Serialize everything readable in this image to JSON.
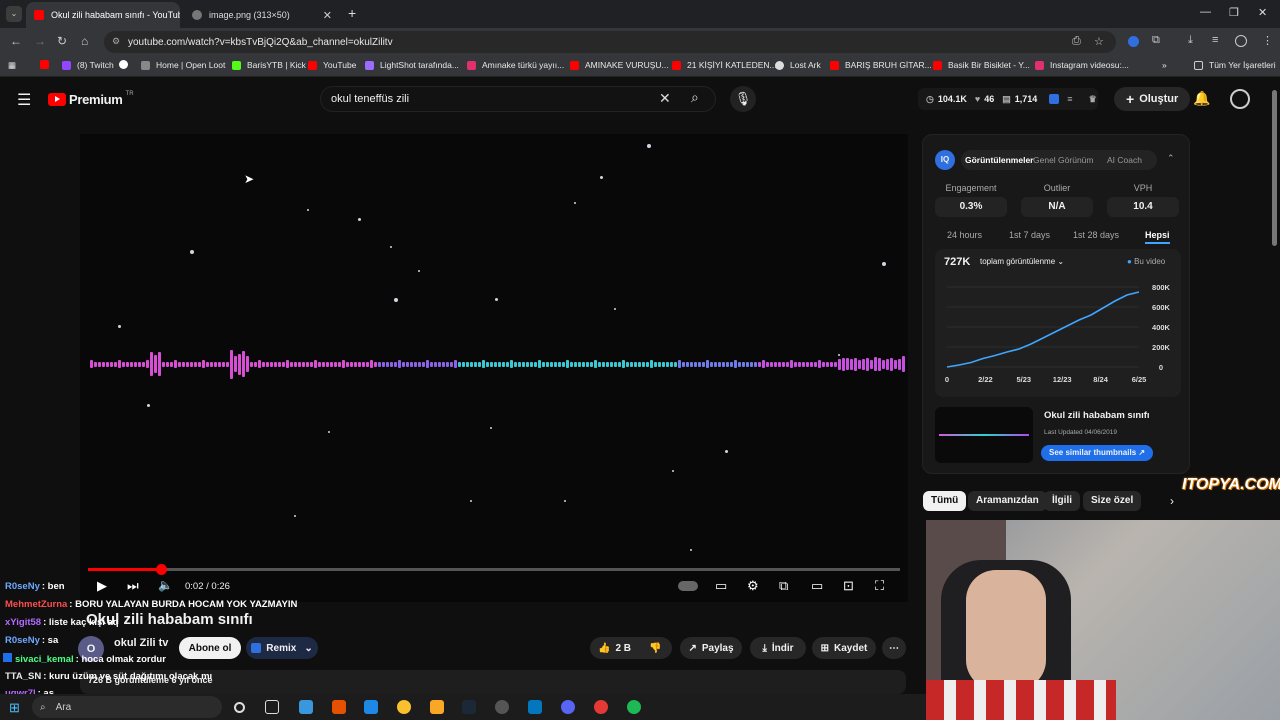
{
  "browser": {
    "tabs": [
      {
        "title": "Okul zili hababam sınıfı - YouTube",
        "active": true
      },
      {
        "title": "image.png (313×50)",
        "active": false
      }
    ],
    "url": "youtube.com/watch?v=kbsTvBjQi2Q&ab_channel=okulZilitv",
    "bookmarks": [
      "(8) Twitch",
      "Home | Open Loot",
      "BarisYTB | Kick",
      "YouTube",
      "LightShot tarafında...",
      "Amınake türkü yayıı...",
      "AMINAKE VURUŞU...",
      "21 KİŞİYİ KATLEDEN...",
      "Lost Ark",
      "BARIŞ BRUH GİTAR...",
      "Basik Bir Bisiklet - Y...",
      "Instagram videosu:..."
    ],
    "all_bookmarks": "Tüm Yer İşaretleri"
  },
  "yt": {
    "logo": "Premium",
    "logo_sup": "TR",
    "search_value": "okul teneffüs zili",
    "stats": {
      "views": "104.1K",
      "likes": "46",
      "subs": "1,714"
    },
    "create": "Oluştur"
  },
  "player": {
    "time": "0:02 / 0:26",
    "progress": 0.09
  },
  "video": {
    "title": "Okul zili hababam sınıfı",
    "channel": "okul Zili tv",
    "channel_initial": "O",
    "subscribe": "Abone ol",
    "remix": "Remix",
    "likes": "2 B",
    "share": "Paylaş",
    "download": "İndir",
    "save": "Kaydet",
    "meta": "726 B görüntüleme  6 yıl önce"
  },
  "chat": [
    {
      "user": "R0seNy",
      "msg": ": ben",
      "color": "#6fa8ff"
    },
    {
      "user": "MehmetZurna",
      "msg": ": BORU YALAYAN BURDA HOCAM YOK YAZMAYIN",
      "color": "#ff4d4d"
    },
    {
      "user": "xYigit58",
      "msg": ": liste kaç kişi aq",
      "color": "#b36bff"
    },
    {
      "user": "R0seNy",
      "msg": ": sa",
      "color": "#6fa8ff"
    },
    {
      "user": "sivaci_kemal",
      "msg": ": hoca olmak zordur",
      "color": "#4dff88"
    },
    {
      "user": "TTA_SN",
      "msg": ": kuru üzüm ve süt dağıtımı olacak mı",
      "color": "#e8e8e8"
    },
    {
      "user": "ugwr7l",
      "msg": ": as",
      "color": "#b36bff"
    }
  ],
  "vidiq": {
    "tabs": [
      "Görüntülenmeler",
      "Genel Görünüm",
      "AI Coach"
    ],
    "metrics": [
      {
        "label": "Engagement",
        "value": "0.3%"
      },
      {
        "label": "Outlier",
        "value": "N/A"
      },
      {
        "label": "VPH",
        "value": "10.4"
      }
    ],
    "ranges": [
      "24 hours",
      "1st 7 days",
      "1st 28 days",
      "Hepsi"
    ],
    "total": "727K",
    "total_label": "toplam görüntülenme",
    "legend": "Bu video",
    "card_title": "Okul zili hababam sınıfı",
    "card_updated": "Last Updated 04/06/2019",
    "card_button": "See similar thumbnails"
  },
  "chart_data": {
    "type": "line",
    "x": [
      "0",
      "2/22",
      "5/23",
      "12/23",
      "8/24",
      "6/25"
    ],
    "yticks": [
      "0",
      "200K",
      "400K",
      "600K",
      "800K"
    ],
    "ylim": [
      0,
      800000
    ],
    "series": [
      {
        "name": "Bu video",
        "values": [
          0,
          20000,
          45000,
          85000,
          115000,
          150000,
          180000,
          230000,
          290000,
          350000,
          410000,
          470000,
          520000,
          590000,
          660000,
          720000,
          750000
        ]
      }
    ],
    "color": "#3ea6ff"
  },
  "chips": [
    "Tümü",
    "Aramanızdan",
    "İlgili",
    "Size özel"
  ],
  "overlay": "ITOPYA.COM",
  "taskbar": {
    "search": "Ara"
  }
}
